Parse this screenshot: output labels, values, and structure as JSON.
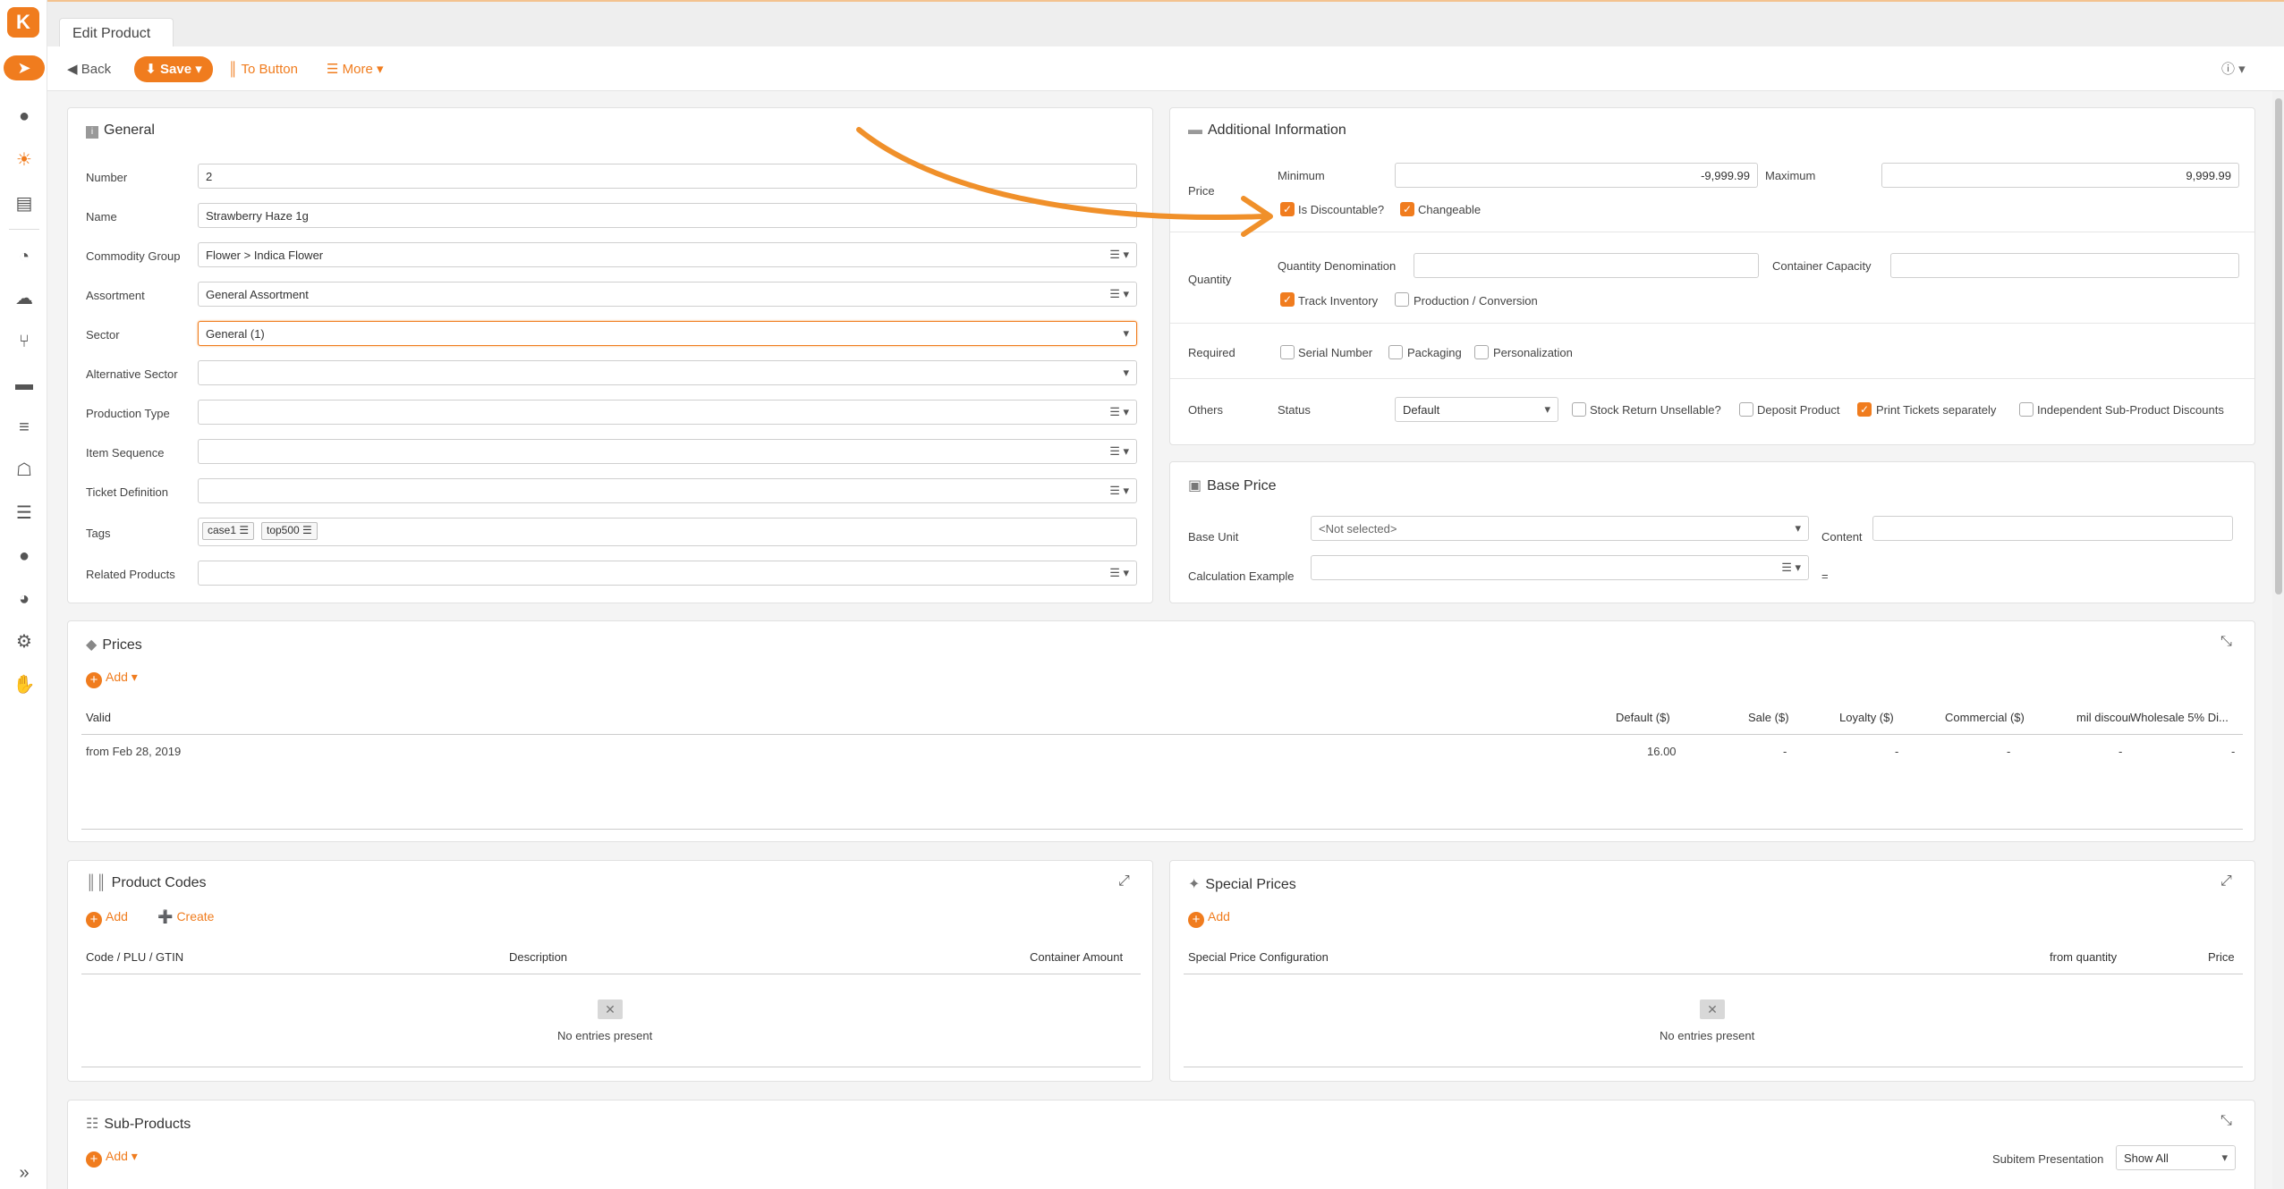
{
  "tab": {
    "title": "Edit Product"
  },
  "toolbar": {
    "back": "Back",
    "save": "Save",
    "to_button": "To Button",
    "more": "More"
  },
  "general": {
    "title": "General",
    "number_label": "Number",
    "number": "2",
    "name_label": "Name",
    "name": "Strawberry Haze 1g",
    "commodity_label": "Commodity Group",
    "commodity": "Flower > Indica Flower",
    "assortment_label": "Assortment",
    "assortment": "General Assortment",
    "sector_label": "Sector",
    "sector": "General (1)",
    "alt_sector_label": "Alternative Sector",
    "production_label": "Production Type",
    "item_seq_label": "Item Sequence",
    "ticket_label": "Ticket Definition",
    "tags_label": "Tags",
    "tags": [
      "case1",
      "top500"
    ],
    "related_label": "Related Products"
  },
  "additional": {
    "title": "Additional Information",
    "price_label": "Price",
    "min_label": "Minimum",
    "min": "-9,999.99",
    "max_label": "Maximum",
    "max": "9,999.99",
    "discountable": "Is Discountable?",
    "changeable": "Changeable",
    "quantity_label": "Quantity",
    "qty_denom_label": "Quantity Denomination",
    "container_label": "Container Capacity",
    "track_inventory": "Track Inventory",
    "production_conv": "Production / Conversion",
    "required_label": "Required",
    "serial": "Serial Number",
    "packaging": "Packaging",
    "personalization": "Personalization",
    "others_label": "Others",
    "status_label": "Status",
    "status": "Default",
    "stock_return": "Stock Return Unsellable?",
    "deposit": "Deposit Product",
    "print_tickets": "Print Tickets separately",
    "indep_discounts": "Independent Sub-Product Discounts"
  },
  "base_price": {
    "title": "Base Price",
    "base_unit_label": "Base Unit",
    "base_unit": "<Not selected>",
    "content_label": "Content",
    "calc_label": "Calculation Example",
    "equals": "="
  },
  "prices": {
    "title": "Prices",
    "add": "Add",
    "columns": [
      "Valid",
      "Default ($)",
      "Sale ($)",
      "Loyalty ($)",
      "Commercial ($)",
      "mil discount ($)",
      "Wholesale 5% Di..."
    ],
    "row": [
      "from Feb 28, 2019",
      "16.00",
      "-",
      "-",
      "-",
      "-",
      "-"
    ]
  },
  "product_codes": {
    "title": "Product Codes",
    "add": "Add",
    "create": "Create",
    "columns": [
      "Code / PLU / GTIN",
      "Description",
      "Container Amount"
    ],
    "empty": "No entries present"
  },
  "special_prices": {
    "title": "Special Prices",
    "add": "Add",
    "columns": [
      "Special Price Configuration",
      "from quantity",
      "Price"
    ],
    "empty": "No entries present"
  },
  "sub_products": {
    "title": "Sub-Products",
    "add": "Add",
    "presentation_label": "Subitem Presentation",
    "presentation": "Show All"
  },
  "colors": {
    "accent": "#f07c1e"
  }
}
